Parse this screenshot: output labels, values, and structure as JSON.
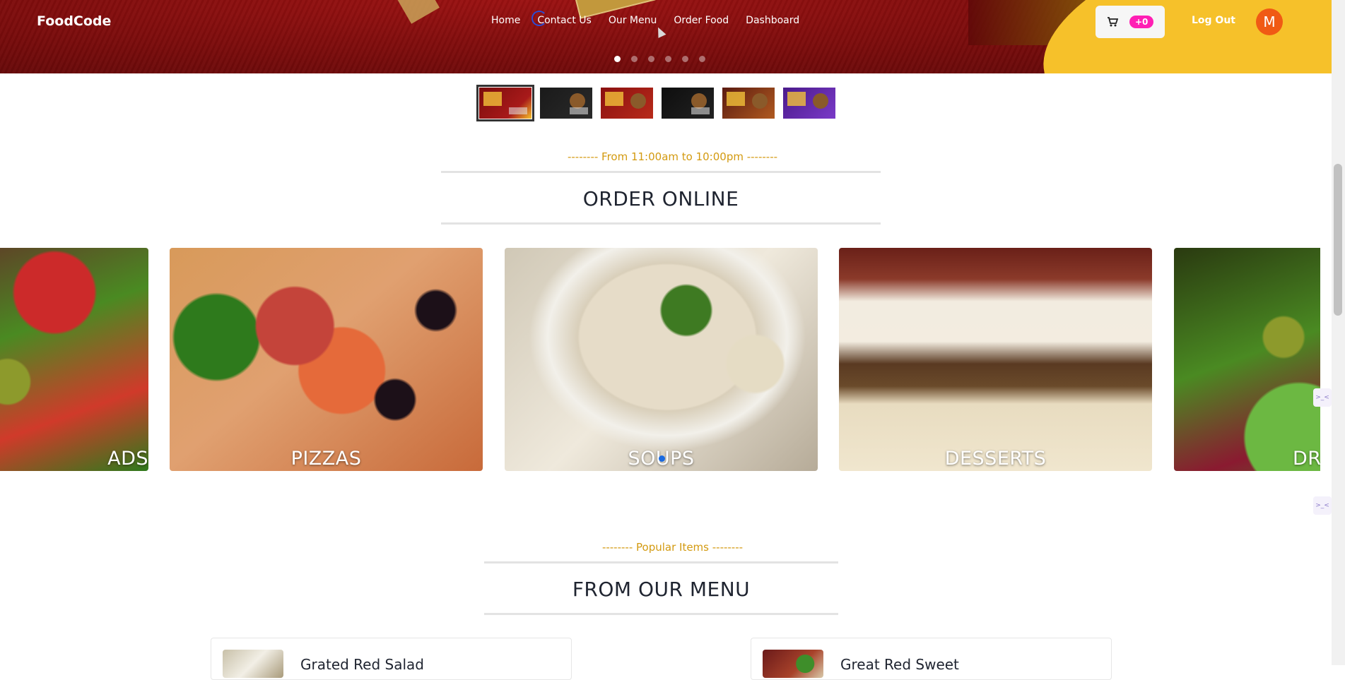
{
  "brand": "FoodCode",
  "nav": {
    "links": [
      "Home",
      "Contact Us",
      "Our Menu",
      "Order Food",
      "Dashboard"
    ],
    "cart_badge": "+0",
    "logout": "Log Out",
    "avatar_initial": "M"
  },
  "hero": {
    "slide_count": 6,
    "active_slide": 1
  },
  "thumbnails": [
    "thumb-1",
    "thumb-2",
    "thumb-3",
    "thumb-4",
    "thumb-5",
    "thumb-6"
  ],
  "order_section": {
    "eyebrow": "-------- From 11:00am to 10:00pm --------",
    "heading": "ORDER ONLINE"
  },
  "categories": [
    "SALADS",
    "PIZZAS",
    "SOUPS",
    "DESSERTS",
    "DR"
  ],
  "categories_visible_text": [
    "ADS",
    "PIZZAS",
    "SOUPS",
    "DESSERTS",
    "DR"
  ],
  "menu_section": {
    "eyebrow": "-------- Popular Items --------",
    "heading": "FROM OUR MENU"
  },
  "menu_items": [
    "Grated Red Salad",
    "Great Red Sweet"
  ],
  "colors": {
    "accent": "#d39a10",
    "hero_red": "#7a0c0c",
    "badge_pink": "#ff1fb4",
    "avatar_orange": "#f05a14"
  }
}
